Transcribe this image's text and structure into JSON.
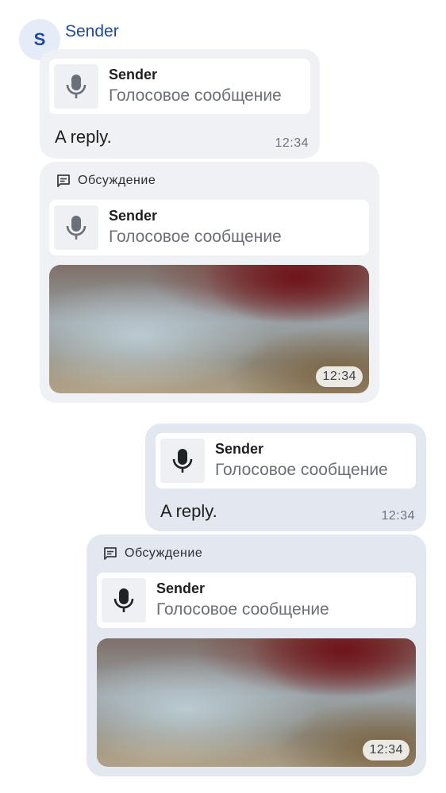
{
  "sender": {
    "initial": "S",
    "name": "Sender"
  },
  "messages": [
    {
      "reply": {
        "sender": "Sender",
        "desc": "Голосовое сообщение"
      },
      "text": "A reply.",
      "time": "12:34"
    },
    {
      "topic": "Обсуждение",
      "reply": {
        "sender": "Sender",
        "desc": "Голосовое сообщение"
      },
      "time": "12:34"
    },
    {
      "reply": {
        "sender": "Sender",
        "desc": "Голосовое сообщение"
      },
      "text": "A reply.",
      "time": "12:34"
    },
    {
      "topic": "Обсуждение",
      "reply": {
        "sender": "Sender",
        "desc": "Голосовое сообщение"
      },
      "time": "12:34"
    }
  ],
  "icons": {
    "mic": "mic-icon",
    "topic": "topic-icon"
  },
  "colors": {
    "accent": "#1c4aa6",
    "incoming_bubble": "#eff1f5",
    "outgoing_bubble": "#e3e7ef"
  }
}
